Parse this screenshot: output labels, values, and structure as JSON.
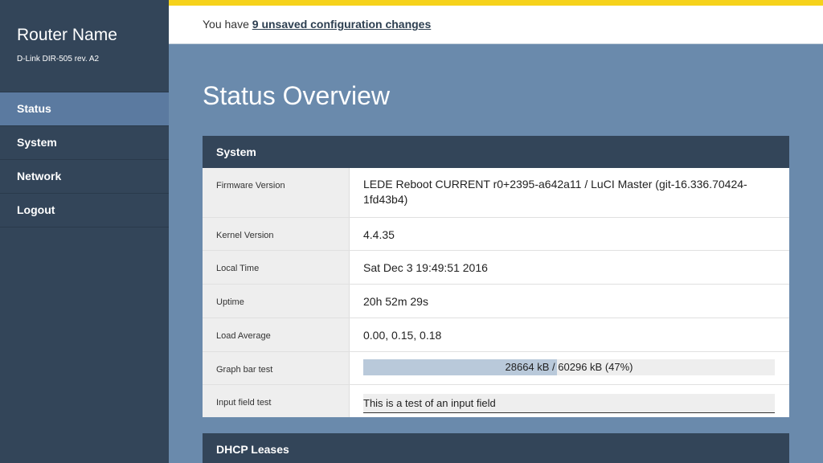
{
  "sidebar": {
    "title": "Router Name",
    "model": "D-Link DIR-505 rev. A2",
    "items": [
      {
        "label": "Status",
        "active": true
      },
      {
        "label": "System",
        "active": false
      },
      {
        "label": "Network",
        "active": false
      },
      {
        "label": "Logout",
        "active": false
      }
    ]
  },
  "topbar": {
    "notice_prefix": "You have ",
    "notice_link": "9 unsaved configuration changes"
  },
  "page": {
    "title": "Status Overview"
  },
  "system_panel": {
    "title": "System",
    "rows": [
      {
        "label": "Firmware Version",
        "value": "LEDE Reboot CURRENT r0+2395-a642a11 / LuCI Master (git-16.336.70424-1fd43b4)"
      },
      {
        "label": "Kernel Version",
        "value": "4.4.35"
      },
      {
        "label": "Local Time",
        "value": "Sat Dec 3 19:49:51 2016"
      },
      {
        "label": "Uptime",
        "value": "20h 52m 29s"
      },
      {
        "label": "Load Average",
        "value": "0.00, 0.15, 0.18"
      },
      {
        "label": "Graph bar test",
        "value": "28664 kB / 60296 kB (47%)",
        "fraction": 0.47
      },
      {
        "label": "Input field test",
        "value": "This is a test of an input field"
      }
    ]
  },
  "dhcp_panel": {
    "title": "DHCP Leases"
  },
  "colors": {
    "sidebar": "#334559",
    "active_nav": "#5b7aa0",
    "background": "#6a8aac",
    "accent": "#f6d21b",
    "bar_fill": "#b9c9da"
  }
}
